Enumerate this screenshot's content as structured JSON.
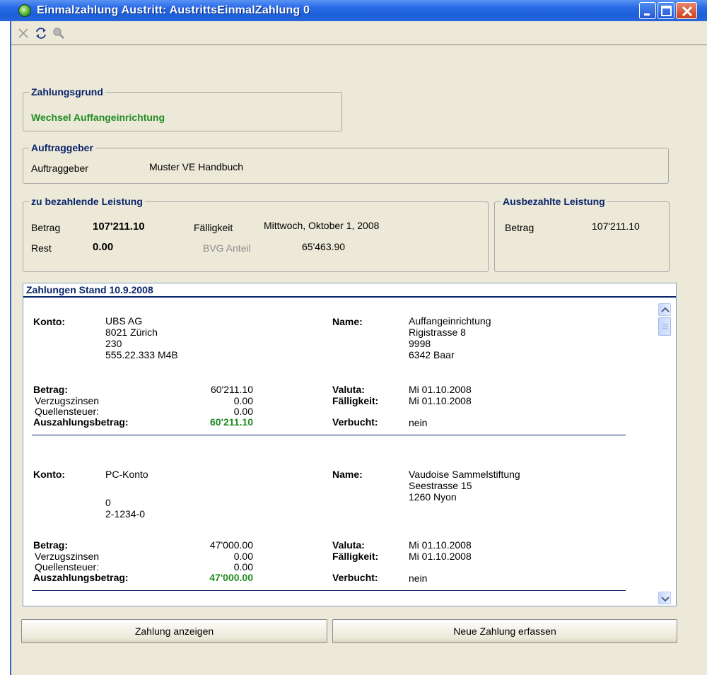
{
  "window": {
    "title": "Einmalzahlung Austritt: AustrittsEinmalZahlung 0"
  },
  "toolbar": {
    "icons": [
      "close-x-icon",
      "refresh-icon",
      "search-icon"
    ]
  },
  "zahlungsgrund": {
    "legend": "Zahlungsgrund",
    "value": "Wechsel Auffangeinrichtung"
  },
  "auftraggeber": {
    "legend": "Auftraggeber",
    "label": "Auftraggeber",
    "value": "Muster VE Handbuch"
  },
  "leistung": {
    "legend": "zu bezahlende Leistung",
    "betrag_label": "Betrag",
    "betrag_value": "107'211.10",
    "rest_label": "Rest",
    "rest_value": "0.00",
    "faelligkeit_label": "Fälligkeit",
    "faelligkeit_value": "Mittwoch, Oktober 1, 2008",
    "bvg_label": "BVG Anteil",
    "bvg_value": "65'463.90"
  },
  "ausbezahlt": {
    "legend": "Ausbezahlte Leistung",
    "betrag_label": "Betrag",
    "betrag_value": "107'211.10"
  },
  "zahlungen": {
    "header": "Zahlungen Stand 10.9.2008",
    "labels": {
      "konto": "Konto:",
      "name": "Name:",
      "betrag": "Betrag:",
      "verzugszinsen": "Verzugszinsen",
      "quellensteuer": "Quellensteuer:",
      "auszahlungsbetrag": "Auszahlungsbetrag:",
      "valuta": "Valuta:",
      "faelligkeit": "Fälligkeit:",
      "verbucht": "Verbucht:"
    },
    "entries": [
      {
        "konto": [
          "UBS AG",
          "8021 Zürich",
          "230",
          "555.22.333 M4B"
        ],
        "name": [
          "Auffangeinrichtung",
          "Rigistrasse 8",
          "9998",
          "6342 Baar"
        ],
        "betrag": "60'211.10",
        "verzugszinsen": "0.00",
        "quellensteuer": "0.00",
        "auszahlungsbetrag": "60'211.10",
        "valuta": "Mi 01.10.2008",
        "faelligkeit": "Mi 01.10.2008",
        "verbucht": "nein"
      },
      {
        "konto": [
          "PC-Konto",
          "",
          "0",
          "2-1234-0"
        ],
        "name": [
          "Vaudoise Sammelstiftung",
          "Seestrasse 15",
          "1260 Nyon",
          ""
        ],
        "betrag": "47'000.00",
        "verzugszinsen": "0.00",
        "quellensteuer": "0.00",
        "auszahlungsbetrag": "47'000.00",
        "valuta": "Mi 01.10.2008",
        "faelligkeit": "Mi 01.10.2008",
        "verbucht": "nein"
      }
    ]
  },
  "buttons": {
    "show": "Zahlung anzeigen",
    "new": "Neue Zahlung erfassen"
  },
  "colors": {
    "title_blue": "#2a6ae8",
    "legend_blue": "#0a246a",
    "green": "#228b22",
    "background": "#ece9d8"
  }
}
